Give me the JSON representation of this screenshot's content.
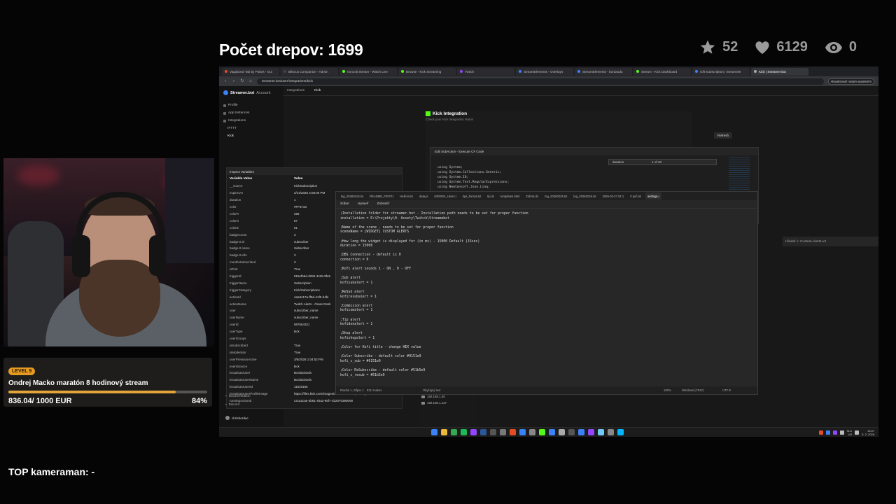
{
  "overlay": {
    "title": "Počet drepov: 1699",
    "stats": {
      "stars": "52",
      "hearts": "6129",
      "views": "0"
    },
    "goal": {
      "level": "LEVEL 9",
      "title": "Ondrej Macko maratón 8 hodinový stream",
      "current": "836.04",
      "target": "/ 1000 EUR",
      "percent": "84%",
      "fraction": 0.84
    },
    "top_cameraman": "TOP kameraman: -"
  },
  "browser": {
    "tabs": [
      {
        "label": "Vagabond Tab by Polars - Gui",
        "color": "#e34c26"
      },
      {
        "label": "Bifocus Companion - Admin",
        "color": "#444"
      },
      {
        "label": "Ironcolt Stream - Watch Live",
        "color": "#53fc18"
      },
      {
        "label": "Browse - Kick Streaming",
        "color": "#53fc18"
      },
      {
        "label": "Twitch",
        "color": "#9146ff"
      },
      {
        "label": "StreamElements - Overlays",
        "color": "#3b82f6"
      },
      {
        "label": "StreamElements - bordaodu",
        "color": "#3b82f6"
      },
      {
        "label": "Stream - Kick Dashboard",
        "color": "#53fc18"
      },
      {
        "label": "Gift Subscription | Streamele",
        "color": "#3b82f6"
      },
      {
        "label": "Kick | Streamer.bot",
        "color": "#aaa"
      }
    ],
    "url": "streamer.bot/user/integrations/kick",
    "update_button": "Aktualizovať novým spustením"
  },
  "app": {
    "brand": "Streamer.bot",
    "account": "Account",
    "breadcrumb": [
      "Integrations",
      "Kick"
    ],
    "sidebar": [
      "Profile",
      "App Instances",
      "Integrations",
      "IFTTT",
      "Kick"
    ],
    "footer": [
      "Documentation",
      "Discord",
      "chrisbordac"
    ],
    "kick_title": "Kick Integration",
    "kick_sub": "Check your Kick integration status",
    "refresh": "Refresh",
    "code_dialog_title": "Edit SubAction - Execute C# Code",
    "search_value": "duration",
    "search_count": "1 of 20",
    "code_lines": [
      "using System;",
      "using System.Collections.Generic;",
      "using System.IO;",
      "using System.Text.RegularExpressions;",
      "using Newtonsoft.Json.Linq;"
    ],
    "search_right": "Hľadať v: Custom-Alerts-v2"
  },
  "vars": {
    "title": "Inspect Variables",
    "col_name": "Variable Value",
    "col_value": "Value",
    "rows": [
      {
        "k": "__source",
        "v": "KickSubscription"
      },
      {
        "k": "expiresAt",
        "v": "2/14/2025 4:08:06 PM"
      },
      {
        "k": "duration",
        "v": "1"
      },
      {
        "k": "color",
        "v": "#FF5733"
      },
      {
        "k": "colorR",
        "v": "255"
      },
      {
        "k": "colorG",
        "v": "87"
      },
      {
        "k": "colorB",
        "v": "51"
      },
      {
        "k": "badgeCount",
        "v": "3"
      },
      {
        "k": "badge.0.id",
        "v": "subscriber"
      },
      {
        "k": "badge.0.name",
        "v": "Subscriber"
      },
      {
        "k": "badge.0.info",
        "v": "3"
      },
      {
        "k": "monthsSubscribed",
        "v": "3"
      },
      {
        "k": "isTest",
        "v": "True"
      },
      {
        "k": "triggerId",
        "v": "816ef56d-d282-4438-9fe5"
      },
      {
        "k": "triggerName",
        "v": "Subscription"
      },
      {
        "k": "triggerCategory",
        "v": "Kick/Subscriptions"
      },
      {
        "k": "actionId",
        "v": "4aa3417a-ff5d-41f0-b4fa"
      },
      {
        "k": "actionName",
        "v": "Twitch Alerts - Clean Desk"
      },
      {
        "k": "user",
        "v": "subscriber_name"
      },
      {
        "k": "userName",
        "v": "subscriber_name"
      },
      {
        "k": "userId",
        "v": "987654321"
      },
      {
        "k": "userType",
        "v": "kick"
      },
      {
        "k": "userGroups",
        "v": ""
      },
      {
        "k": "isSubscribed",
        "v": "True"
      },
      {
        "k": "isModerator",
        "v": "True"
      },
      {
        "k": "userPreviousActive",
        "v": "3/5/2026 1:04:52 PM"
      },
      {
        "k": "eventSource",
        "v": "kick"
      },
      {
        "k": "broadcastUser",
        "v": "Bordaclands"
      },
      {
        "k": "broadcastUserName",
        "v": "Bordaclands"
      },
      {
        "k": "broadcastUserId",
        "v": "11526165"
      },
      {
        "k": "broadcastUserProfileImage",
        "v": "https://files.kick.com/images/user/11526165/profile_im"
      },
      {
        "k": "runningActionId",
        "v": "c2ca2ca6-4b61-40a2-95f7-1b2070390090"
      }
    ]
  },
  "notepad": {
    "tabs": [
      "log_20260218.txt",
      "README_FIRST.t",
      "Hello Kick",
      "data.js",
      "HIDDEN_Users.t",
      "tips_format.txt",
      "tip.ini",
      "templates.html",
      "Zobrat.do",
      "log_20260225.txt",
      "log_20260226.txt",
      "2026-02-27 01:1",
      "# poč.txt",
      "settings.i"
    ],
    "menu": [
      "Súbor",
      "Upraviť",
      "Zobraziť"
    ],
    "lines": [
      ";Installation folder for streamer.bot - Installation path needs to be set for proper function",
      "installation = D:\\Projekty\\0. Assety\\Twitch\\Streamebot",
      "",
      ";Name of the scene - needs to be set for proper function",
      "sceneName = [WIDGET] CUSTOM ALERTS",
      "",
      ";How long the widget is displayed for (in ms) - 15000 Default (15sec)",
      "duration = 15000",
      "",
      ";OBS Connection - default is 0",
      "connection = 0",
      "",
      ";Kofi alert sounds 1 - ON , 0 - OFF",
      "",
      ";Sub alert",
      "kofisubalert = 1",
      "",
      ";ReSub alert",
      "kofiresubalert = 1",
      "",
      ";Commision alert",
      "koficomalert = 1",
      "",
      ";Tip alert",
      "kofidonalert = 1",
      "",
      ";Shop alert",
      "kofishopalert = 1",
      "",
      ";Color for Kofi title - change HEX value",
      "",
      ";Color Subscribe - default color #9151e9",
      "kofi_c_sub = #9151e9",
      "",
      ";Color ReSubscribe - default color #51b5e9",
      "kofi_c_resub = #51b5e9"
    ],
    "status": [
      "Riadok 1, Stĺpec 1",
      "821 znakov",
      "Obyčajný text",
      "100%",
      "Windows (CRLF)",
      "UTF-8"
    ]
  },
  "explorer": [
    "01.03.2026_WEBDL_Twitter",
    "Custom-Alerts-v2",
    "Tento počítač",
    "192.168.1.30",
    "192.168.1.127"
  ],
  "tray": {
    "lang": "SLK",
    "lang2": "US",
    "time": "13:07",
    "date": "5. 3. 2026"
  }
}
